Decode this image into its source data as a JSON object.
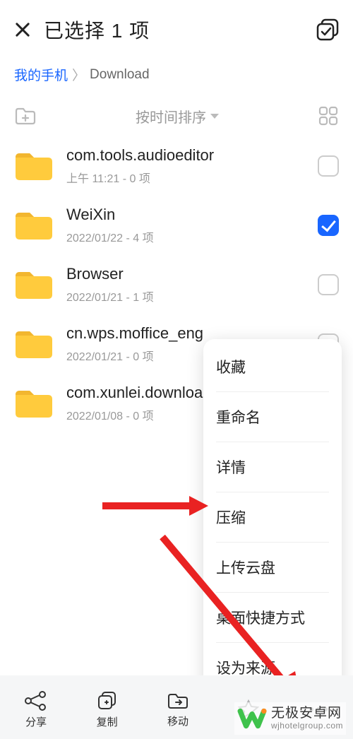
{
  "header": {
    "title": "已选择 1 项"
  },
  "breadcrumb": {
    "root": "我的手机",
    "current": "Download"
  },
  "sort": {
    "label": "按时间排序"
  },
  "items": [
    {
      "name": "com.tools.audioeditor",
      "sub": "上午 11:21  - 0 项",
      "checked": false
    },
    {
      "name": "WeiXin",
      "sub": "2022/01/22 - 4 项",
      "checked": true
    },
    {
      "name": "Browser",
      "sub": "2022/01/21 - 1 项",
      "checked": false
    },
    {
      "name": "cn.wps.moffice_eng",
      "sub": "2022/01/21 - 0 项",
      "checked": false
    },
    {
      "name": "com.xunlei.downloadprovider",
      "sub": "2022/01/08 - 0 项",
      "checked": false
    }
  ],
  "context_menu": [
    "收藏",
    "重命名",
    "详情",
    "压缩",
    "上传云盘",
    "桌面快捷方式",
    "设为来源"
  ],
  "actions": {
    "share": "分享",
    "copy": "复制",
    "move": "移动"
  },
  "watermark": {
    "title": "无极安卓网",
    "url": "wjhotelgroup.com"
  }
}
